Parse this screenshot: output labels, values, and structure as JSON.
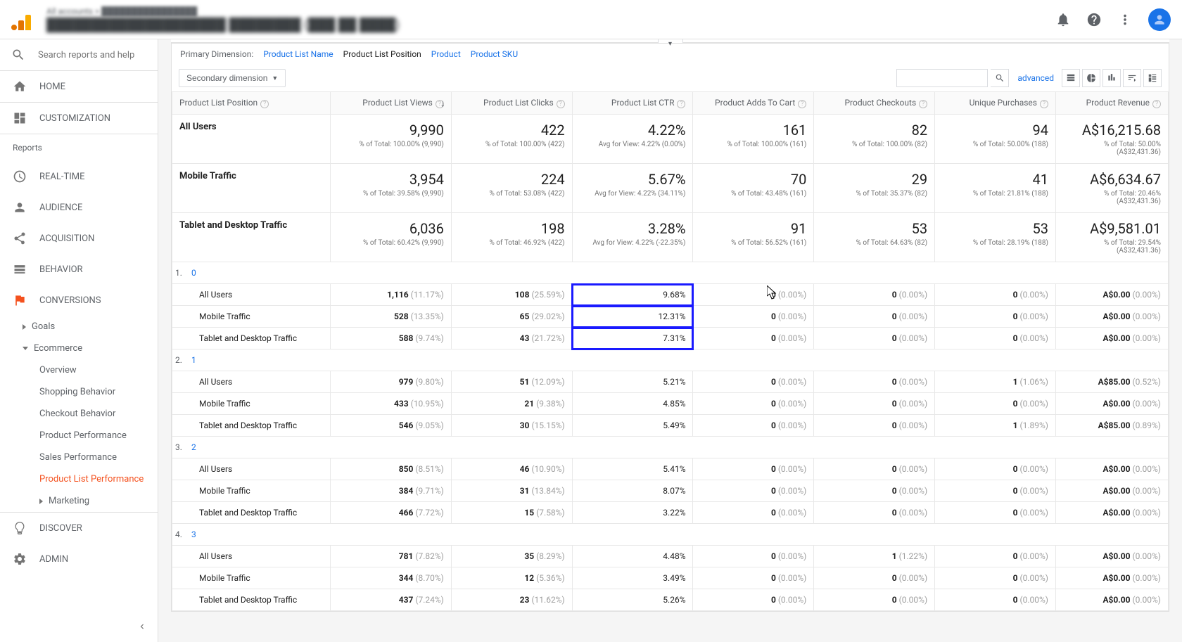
{
  "header": {
    "breadcrumb_top": "All accounts > ████████████████",
    "breadcrumb_bottom": "████████████████████ ████████ (███ ██ ████)"
  },
  "sidebar": {
    "search_placeholder": "Search reports and help",
    "home": "HOME",
    "customization": "CUSTOMIZATION",
    "reports_label": "Reports",
    "realtime": "REAL-TIME",
    "audience": "AUDIENCE",
    "acquisition": "ACQUISITION",
    "behavior": "BEHAVIOR",
    "conversions": "CONVERSIONS",
    "goals": "Goals",
    "ecommerce": "Ecommerce",
    "overview": "Overview",
    "shopping_behavior": "Shopping Behavior",
    "checkout_behavior": "Checkout Behavior",
    "product_performance": "Product Performance",
    "sales_performance": "Sales Performance",
    "product_list_performance": "Product List Performance",
    "marketing": "Marketing",
    "discover": "DISCOVER",
    "admin": "ADMIN"
  },
  "dimensions": {
    "label": "Primary Dimension:",
    "d1": "Product List Name",
    "d2": "Product List Position",
    "d3": "Product",
    "d4": "Product SKU"
  },
  "controls": {
    "secondary": "Secondary dimension",
    "advanced": "advanced"
  },
  "columns": {
    "c0": "Product List Position",
    "c1": "Product List Views",
    "c2": "Product List Clicks",
    "c3": "Product List CTR",
    "c4": "Product Adds To Cart",
    "c5": "Product Checkouts",
    "c6": "Unique Purchases",
    "c7": "Product Revenue"
  },
  "summaries": [
    {
      "label": "All Users",
      "views": "9,990",
      "views_sub": "% of Total: 100.00% (9,990)",
      "clicks": "422",
      "clicks_sub": "% of Total: 100.00% (422)",
      "ctr": "4.22%",
      "ctr_sub": "Avg for View: 4.22% (0.00%)",
      "adds": "161",
      "adds_sub": "% of Total: 100.00% (161)",
      "checkouts": "82",
      "checkouts_sub": "% of Total: 100.00% (82)",
      "purchases": "94",
      "purchases_sub": "% of Total: 50.00% (188)",
      "revenue": "A$16,215.68",
      "revenue_sub": "% of Total: 50.00% (A$32,431.36)"
    },
    {
      "label": "Mobile Traffic",
      "views": "3,954",
      "views_sub": "% of Total: 39.58% (9,990)",
      "clicks": "224",
      "clicks_sub": "% of Total: 53.08% (422)",
      "ctr": "5.67%",
      "ctr_sub": "Avg for View: 4.22% (34.11%)",
      "adds": "70",
      "adds_sub": "% of Total: 43.48% (161)",
      "checkouts": "29",
      "checkouts_sub": "% of Total: 35.37% (82)",
      "purchases": "41",
      "purchases_sub": "% of Total: 21.81% (188)",
      "revenue": "A$6,634.67",
      "revenue_sub": "% of Total: 20.46% (A$32,431.36)"
    },
    {
      "label": "Tablet and Desktop Traffic",
      "views": "6,036",
      "views_sub": "% of Total: 60.42% (9,990)",
      "clicks": "198",
      "clicks_sub": "% of Total: 46.92% (422)",
      "ctr": "3.28%",
      "ctr_sub": "Avg for View: 4.22% (-22.35%)",
      "adds": "91",
      "adds_sub": "% of Total: 56.52% (161)",
      "checkouts": "53",
      "checkouts_sub": "% of Total: 64.63% (82)",
      "purchases": "53",
      "purchases_sub": "% of Total: 28.19% (188)",
      "revenue": "A$9,581.01",
      "revenue_sub": "% of Total: 29.54% (A$32,431.36)"
    }
  ],
  "groups": [
    {
      "idx": "1.",
      "pos": "0",
      "rows": [
        {
          "label": "All Users",
          "views": "1,116",
          "views_pct": "(11.17%)",
          "clicks": "108",
          "clicks_pct": "(25.59%)",
          "ctr": "9.68%",
          "adds": "0",
          "adds_pct": "(0.00%)",
          "checkouts": "0",
          "checkouts_pct": "(0.00%)",
          "purchases": "0",
          "purchases_pct": "(0.00%)",
          "revenue": "A$0.00",
          "revenue_pct": "(0.00%)",
          "hl": true
        },
        {
          "label": "Mobile Traffic",
          "views": "528",
          "views_pct": "(13.35%)",
          "clicks": "65",
          "clicks_pct": "(29.02%)",
          "ctr": "12.31%",
          "adds": "0",
          "adds_pct": "(0.00%)",
          "checkouts": "0",
          "checkouts_pct": "(0.00%)",
          "purchases": "0",
          "purchases_pct": "(0.00%)",
          "revenue": "A$0.00",
          "revenue_pct": "(0.00%)",
          "hl": true
        },
        {
          "label": "Tablet and Desktop Traffic",
          "views": "588",
          "views_pct": "(9.74%)",
          "clicks": "43",
          "clicks_pct": "(21.72%)",
          "ctr": "7.31%",
          "adds": "0",
          "adds_pct": "(0.00%)",
          "checkouts": "0",
          "checkouts_pct": "(0.00%)",
          "purchases": "0",
          "purchases_pct": "(0.00%)",
          "revenue": "A$0.00",
          "revenue_pct": "(0.00%)",
          "hl": true
        }
      ]
    },
    {
      "idx": "2.",
      "pos": "1",
      "rows": [
        {
          "label": "All Users",
          "views": "979",
          "views_pct": "(9.80%)",
          "clicks": "51",
          "clicks_pct": "(12.09%)",
          "ctr": "5.21%",
          "adds": "0",
          "adds_pct": "(0.00%)",
          "checkouts": "0",
          "checkouts_pct": "(0.00%)",
          "purchases": "1",
          "purchases_pct": "(1.06%)",
          "revenue": "A$85.00",
          "revenue_pct": "(0.52%)"
        },
        {
          "label": "Mobile Traffic",
          "views": "433",
          "views_pct": "(10.95%)",
          "clicks": "21",
          "clicks_pct": "(9.38%)",
          "ctr": "4.85%",
          "adds": "0",
          "adds_pct": "(0.00%)",
          "checkouts": "0",
          "checkouts_pct": "(0.00%)",
          "purchases": "0",
          "purchases_pct": "(0.00%)",
          "revenue": "A$0.00",
          "revenue_pct": "(0.00%)"
        },
        {
          "label": "Tablet and Desktop Traffic",
          "views": "546",
          "views_pct": "(9.05%)",
          "clicks": "30",
          "clicks_pct": "(15.15%)",
          "ctr": "5.49%",
          "adds": "0",
          "adds_pct": "(0.00%)",
          "checkouts": "0",
          "checkouts_pct": "(0.00%)",
          "purchases": "1",
          "purchases_pct": "(1.89%)",
          "revenue": "A$85.00",
          "revenue_pct": "(0.89%)"
        }
      ]
    },
    {
      "idx": "3.",
      "pos": "2",
      "rows": [
        {
          "label": "All Users",
          "views": "850",
          "views_pct": "(8.51%)",
          "clicks": "46",
          "clicks_pct": "(10.90%)",
          "ctr": "5.41%",
          "adds": "0",
          "adds_pct": "(0.00%)",
          "checkouts": "0",
          "checkouts_pct": "(0.00%)",
          "purchases": "0",
          "purchases_pct": "(0.00%)",
          "revenue": "A$0.00",
          "revenue_pct": "(0.00%)"
        },
        {
          "label": "Mobile Traffic",
          "views": "384",
          "views_pct": "(9.71%)",
          "clicks": "31",
          "clicks_pct": "(13.84%)",
          "ctr": "8.07%",
          "adds": "0",
          "adds_pct": "(0.00%)",
          "checkouts": "0",
          "checkouts_pct": "(0.00%)",
          "purchases": "0",
          "purchases_pct": "(0.00%)",
          "revenue": "A$0.00",
          "revenue_pct": "(0.00%)"
        },
        {
          "label": "Tablet and Desktop Traffic",
          "views": "466",
          "views_pct": "(7.72%)",
          "clicks": "15",
          "clicks_pct": "(7.58%)",
          "ctr": "3.22%",
          "adds": "0",
          "adds_pct": "(0.00%)",
          "checkouts": "0",
          "checkouts_pct": "(0.00%)",
          "purchases": "0",
          "purchases_pct": "(0.00%)",
          "revenue": "A$0.00",
          "revenue_pct": "(0.00%)"
        }
      ]
    },
    {
      "idx": "4.",
      "pos": "3",
      "rows": [
        {
          "label": "All Users",
          "views": "781",
          "views_pct": "(7.82%)",
          "clicks": "35",
          "clicks_pct": "(8.29%)",
          "ctr": "4.48%",
          "adds": "0",
          "adds_pct": "(0.00%)",
          "checkouts": "1",
          "checkouts_pct": "(1.22%)",
          "purchases": "0",
          "purchases_pct": "(0.00%)",
          "revenue": "A$0.00",
          "revenue_pct": "(0.00%)"
        },
        {
          "label": "Mobile Traffic",
          "views": "344",
          "views_pct": "(8.70%)",
          "clicks": "12",
          "clicks_pct": "(5.36%)",
          "ctr": "3.49%",
          "adds": "0",
          "adds_pct": "(0.00%)",
          "checkouts": "0",
          "checkouts_pct": "(0.00%)",
          "purchases": "0",
          "purchases_pct": "(0.00%)",
          "revenue": "A$0.00",
          "revenue_pct": "(0.00%)"
        },
        {
          "label": "Tablet and Desktop Traffic",
          "views": "437",
          "views_pct": "(7.24%)",
          "clicks": "23",
          "clicks_pct": "(11.62%)",
          "ctr": "5.26%",
          "adds": "0",
          "adds_pct": "(0.00%)",
          "checkouts": "0",
          "checkouts_pct": "(0.00%)",
          "purchases": "0",
          "purchases_pct": "(0.00%)",
          "revenue": "A$0.00",
          "revenue_pct": "(0.00%)"
        }
      ]
    }
  ]
}
